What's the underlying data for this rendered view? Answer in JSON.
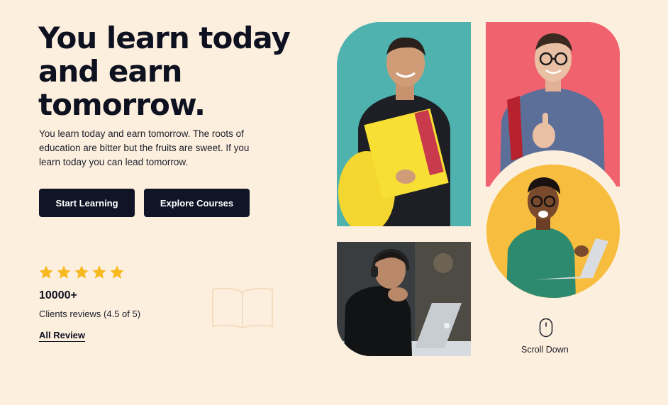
{
  "hero": {
    "title": "You learn today and earn tomorrow.",
    "description": "You learn today and earn tomorrow. The roots of education are bitter but the fruits are sweet. If you learn today you can lead tomorrow."
  },
  "buttons": {
    "start": "Start Learning",
    "explore": "Explore Courses"
  },
  "reviews": {
    "rating_stars": 5,
    "count": "10000+",
    "text": "Clients reviews (4.5 of 5)",
    "link": "All Review"
  },
  "scroll": {
    "label": "Scroll Down"
  },
  "colors": {
    "background": "#fdefde",
    "button": "#0f1426",
    "star": "#f8b920",
    "teal": "#4fb2ae",
    "pink": "#f0636e",
    "yellow": "#f7bd3f"
  }
}
